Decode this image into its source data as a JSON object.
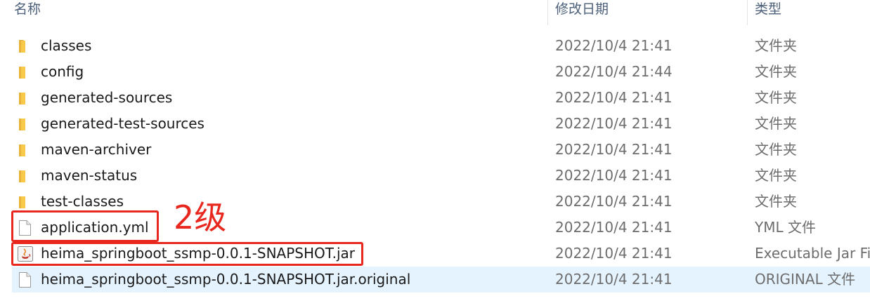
{
  "columns": {
    "name": "名称",
    "date": "修改日期",
    "type": "类型"
  },
  "rows": [
    {
      "name": "classes",
      "date": "2022/10/4 21:41",
      "type": "文件夹",
      "icon": "folder-icon"
    },
    {
      "name": "config",
      "date": "2022/10/4 21:44",
      "type": "文件夹",
      "icon": "folder-icon"
    },
    {
      "name": "generated-sources",
      "date": "2022/10/4 21:41",
      "type": "文件夹",
      "icon": "folder-icon"
    },
    {
      "name": "generated-test-sources",
      "date": "2022/10/4 21:41",
      "type": "文件夹",
      "icon": "folder-icon"
    },
    {
      "name": "maven-archiver",
      "date": "2022/10/4 21:41",
      "type": "文件夹",
      "icon": "folder-icon"
    },
    {
      "name": "maven-status",
      "date": "2022/10/4 21:41",
      "type": "文件夹",
      "icon": "folder-icon"
    },
    {
      "name": "test-classes",
      "date": "2022/10/4 21:41",
      "type": "文件夹",
      "icon": "folder-icon"
    },
    {
      "name": "application.yml",
      "date": "2022/10/4 21:41",
      "type": "YML 文件",
      "icon": "file-icon"
    },
    {
      "name": "heima_springboot_ssmp-0.0.1-SNAPSHOT.jar",
      "date": "2022/10/4 21:41",
      "type": "Executable Jar Fi",
      "icon": "java-jar-icon"
    },
    {
      "name": "heima_springboot_ssmp-0.0.1-SNAPSHOT.jar.original",
      "date": "2022/10/4 21:41",
      "type": "ORIGINAL 文件",
      "icon": "file-icon",
      "selected": true
    }
  ],
  "annotation": {
    "text": "2级"
  },
  "colors": {
    "header_text": "#4c607a",
    "folder_yellow": "#f8c94a",
    "selection": "#e5f3ff",
    "annotation_red": "#e8271f"
  }
}
